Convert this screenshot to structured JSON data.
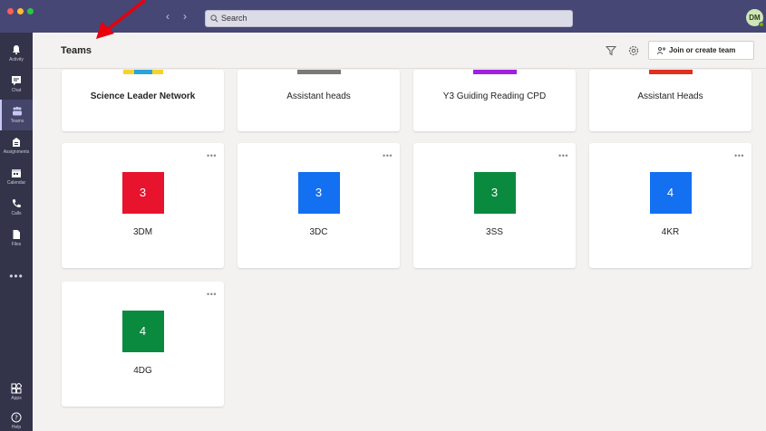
{
  "window": {
    "search_placeholder": "Search",
    "avatar_initials": "DM"
  },
  "rail": {
    "items": [
      {
        "label": "Activity",
        "icon": "bell-icon"
      },
      {
        "label": "Chat",
        "icon": "chat-icon"
      },
      {
        "label": "Teams",
        "icon": "teams-icon",
        "active": true
      },
      {
        "label": "Assignments",
        "icon": "assignments-icon"
      },
      {
        "label": "Calendar",
        "icon": "calendar-icon"
      },
      {
        "label": "Calls",
        "icon": "phone-icon"
      },
      {
        "label": "Files",
        "icon": "file-icon"
      }
    ],
    "more": "•••",
    "bottom_items": [
      {
        "label": "Apps",
        "icon": "apps-icon"
      },
      {
        "label": "Help",
        "icon": "help-icon"
      }
    ]
  },
  "header": {
    "title": "Teams",
    "join_label": "Join or create team"
  },
  "teams_row1": [
    {
      "name": "Science Leader Network",
      "strip_color": "#f8d22a"
    },
    {
      "name": "Assistant heads",
      "strip_color": "#7a7a7a"
    },
    {
      "name": "Y3 Guiding Reading CPD",
      "strip_color": "#a11fe0"
    },
    {
      "name": "Assistant Heads",
      "strip_color": "#e0301e"
    }
  ],
  "teams_row2": [
    {
      "name": "3DM",
      "tile": "3",
      "color": "#e8132d"
    },
    {
      "name": "3DC",
      "tile": "3",
      "color": "#1370f0"
    },
    {
      "name": "3SS",
      "tile": "3",
      "color": "#0a8a3e"
    },
    {
      "name": "4KR",
      "tile": "4",
      "color": "#1370f0"
    }
  ],
  "teams_row3": [
    {
      "name": "4DG",
      "tile": "4",
      "color": "#0a8a3e"
    }
  ],
  "more_options": "•••",
  "colors": {
    "titlebar": "#464775",
    "rail": "#33344a",
    "annotation_arrow": "#e8000b"
  }
}
